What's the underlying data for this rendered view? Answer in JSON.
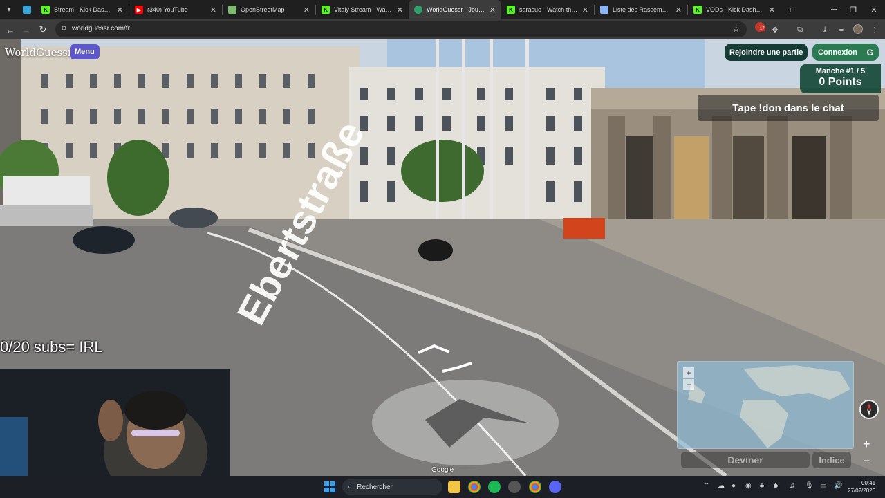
{
  "browser": {
    "tabs": [
      {
        "title": "Stream - Kick Dashboard",
        "favicon": "kick-icon",
        "color": "#53fc18",
        "active": false
      },
      {
        "title": "(340) YouTube",
        "favicon": "youtube-icon",
        "color": "#ff0000",
        "active": false
      },
      {
        "title": "OpenStreetMap",
        "favicon": "osm-icon",
        "color": "#7ebc6f",
        "active": false
      },
      {
        "title": "Vitaly Stream - Watch Li",
        "favicon": "kick-icon",
        "color": "#53fc18",
        "active": false
      },
      {
        "title": "WorldGuessr - Jouez à G",
        "favicon": "worldguessr-icon",
        "color": "#2fa36b",
        "active": true
      },
      {
        "title": "sarasue - Watch the VOD",
        "favicon": "kick-icon",
        "color": "#53fc18",
        "active": false
      },
      {
        "title": "Liste des Rassemblemen",
        "favicon": "doc-icon",
        "color": "#8ab4f8",
        "active": false
      },
      {
        "title": "VODs - Kick Dashboard",
        "favicon": "kick-icon",
        "color": "#53fc18",
        "active": false
      }
    ],
    "url": "worldguessr.com/fr",
    "extension_badge": "17"
  },
  "game": {
    "logo": "WorldGuessr",
    "menu_label": "Menu",
    "join_label": "Rejoindre une partie",
    "login_label": "Connexion",
    "login_icon": "G",
    "round_label": "Manche #1 / 5",
    "points_label": "0 Points",
    "chat_banner": "Tape !don dans le chat",
    "subs_overlay": "0/20 subs= IRL",
    "street_name": "Ebertstraße",
    "google_attribution": "Google",
    "guess_label": "Deviner",
    "hint_label": "Indice",
    "map_zoom_in": "+",
    "map_zoom_out": "−",
    "sv_zoom_in": "+",
    "sv_zoom_out": "−"
  },
  "taskbar": {
    "search_placeholder": "Rechercher",
    "time": "00:41",
    "date": "27/02/2026"
  },
  "colors": {
    "menu_button": "#5e57c9",
    "join_button": "#153b34",
    "login_button": "#2c7a52",
    "round_box": "#124634"
  }
}
